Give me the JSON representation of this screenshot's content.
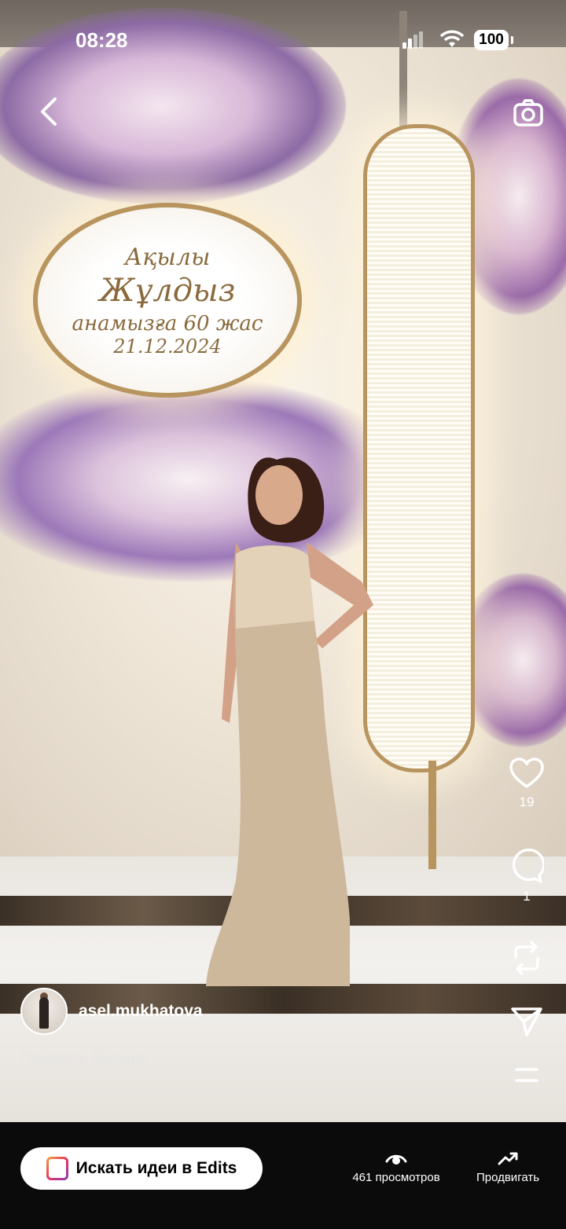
{
  "status_bar": {
    "time": "08:28",
    "battery": "100"
  },
  "photo": {
    "sign": {
      "line1": "Ақылы",
      "line2": "Жұлдыз",
      "line3": "анамызға 60 жас",
      "line4": "21.12.2024"
    }
  },
  "actions": {
    "likes": "19",
    "comments": "1"
  },
  "post": {
    "username": "asel.mukhatova",
    "show_more": "Показать больше"
  },
  "bottom_bar": {
    "edits_label": "Искать идеи в Edits",
    "views_label": "461 просмотров",
    "promote_label": "Продвигать"
  },
  "colors": {
    "accent_gold": "#b8955f",
    "bar_bg": "#0b0b0b"
  }
}
